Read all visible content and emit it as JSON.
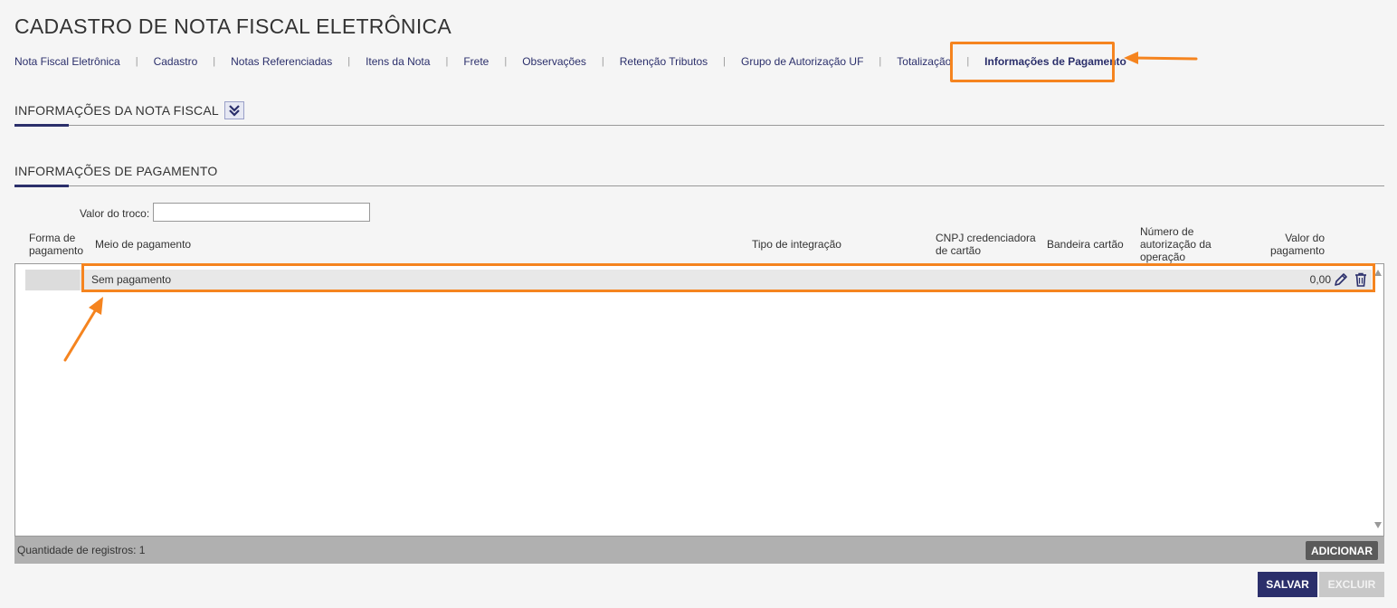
{
  "page": {
    "title": "CADASTRO DE NOTA FISCAL ELETRÔNICA"
  },
  "tabs": [
    {
      "label": "Nota Fiscal Eletrônica"
    },
    {
      "label": "Cadastro"
    },
    {
      "label": "Notas Referenciadas"
    },
    {
      "label": "Itens da Nota"
    },
    {
      "label": "Frete"
    },
    {
      "label": "Observações"
    },
    {
      "label": "Retenção Tributos"
    },
    {
      "label": "Grupo de Autorização UF"
    },
    {
      "label": "Totalização"
    },
    {
      "label": "Informações de Pagamento",
      "active": true
    }
  ],
  "sections": {
    "nota_fiscal": {
      "title": "INFORMAÇÕES DA NOTA FISCAL"
    },
    "pagamento": {
      "title": "INFORMAÇÕES DE PAGAMENTO"
    }
  },
  "troco": {
    "label": "Valor do troco:",
    "value": ""
  },
  "grid": {
    "columns": {
      "forma": "Forma de pagamento",
      "meio": "Meio de pagamento",
      "tipo": "Tipo de integração",
      "cnpj": "CNPJ credenciadora de cartão",
      "bandeira": "Bandeira cartão",
      "numero": "Número de autorização da operação",
      "valor": "Valor do pagamento"
    },
    "rows": [
      {
        "forma": "",
        "meio": "Sem pagamento",
        "tipo": "",
        "cnpj": "",
        "bandeira": "",
        "numero": "",
        "valor": "0,00"
      }
    ],
    "footer": {
      "count_label": "Quantidade de registros: 1",
      "add_label": "ADICIONAR"
    }
  },
  "actions": {
    "save_label": "SALVAR",
    "delete_label": "EXCLUIR"
  },
  "colors": {
    "accent": "#2b2f6b",
    "highlight": "#f5841f"
  }
}
